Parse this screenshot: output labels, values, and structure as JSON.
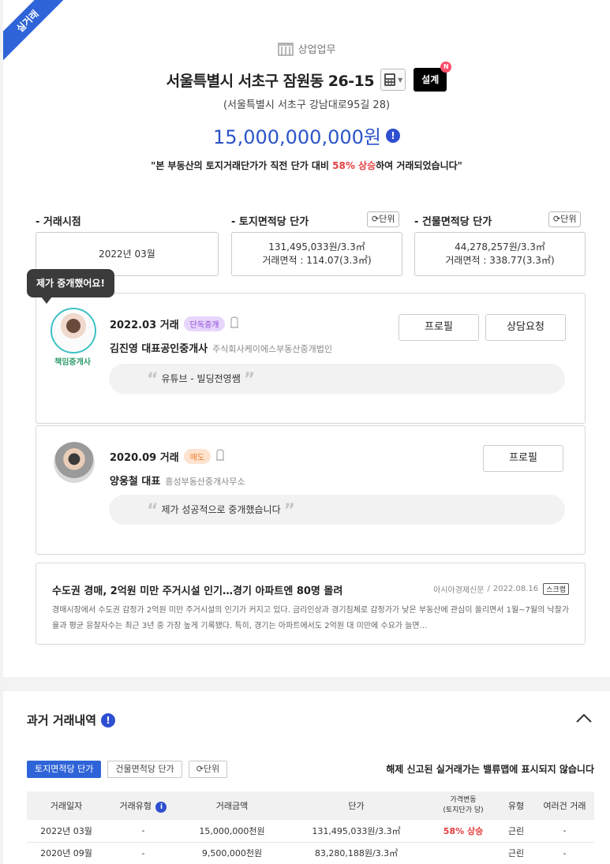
{
  "ribbon": "실거래",
  "category": "상업업무",
  "address": "서울특별시 서초구 잠원동 26-15",
  "design_label": "설계",
  "design_new": "N",
  "road_address": "(서울특별시 서초구 강남대로95길 28)",
  "price": "15,000,000,000원",
  "message_pre": "\"본 부동산의 토지거래단가가 직전 단가 대비",
  "message_highlight": "58% 상승",
  "message_post": "하여 거래되었습니다\"",
  "colors": {
    "accent_blue": "#2f64d8",
    "price_blue": "#2b54c8",
    "rise_red": "#e63e3e"
  },
  "summary": {
    "trade_date": {
      "label": "- 거래시점",
      "value": "2022년 03월"
    },
    "land_unit": {
      "label": "- 토지면적당 단가",
      "unit_btn": "단위",
      "line1": "131,495,033원/3.3㎡",
      "line2": "거래면적 : 114.07(3.3㎡)"
    },
    "building_unit": {
      "label": "- 건물면적당 단가",
      "unit_btn": "단위",
      "line1": "44,278,257원/3.3㎡",
      "line2": "거래면적 : 338.77(3.3㎡)"
    }
  },
  "tooltip": "제가 중개했어요!",
  "agents": [
    {
      "deal": "2022.03 거래",
      "badge": "단독중개",
      "name": "김진영 대표공인중개사",
      "company": "주식회사케이에스부동산중개법인",
      "tag": "책임중개사",
      "quote": "유튜브 - 빌딩전영쌤",
      "btn_profile": "프로필",
      "btn_consult": "상담요청"
    },
    {
      "deal": "2020.09 거래",
      "badge": "매도",
      "name": "양웅철 대표",
      "company": "흥성부동산중개사무소",
      "quote": "제가 성공적으로 중개했습니다",
      "btn_profile": "프로필"
    }
  ],
  "news": {
    "title": "수도권 경매, 2억원 미만 주거시설 인기…경기 아파트엔 80명 몰려",
    "source": "아시아경제신문",
    "date": "2022.08.16",
    "scrap": "스크랩",
    "body": "경매시장에서 수도권 감정가 2억원 미만 주거시설의 인기가 커지고 있다. 금리인상과 경기침체로 감정가가 낮은 부동산에 관심이 쏠리면서 1월~7월의 낙찰가율과 평균 응찰자수는 최근 3년 중 가장 높게 기록됐다. 특히, 경기는 아파트에서도 2억원 대 미만에 수요가 늘면…"
  },
  "history": {
    "title": "과거 거래내역",
    "tabs": [
      "토지면적당 단가",
      "건물면적당 단가",
      "단위"
    ],
    "notice": "해제 신고된 실거래가는 밸류맵에 표시되지 않습니다",
    "headers": [
      "거래일자",
      "거래유형",
      "거래금액",
      "단가",
      "가격변동",
      "(토지단가 당)",
      "유형",
      "여러건 거래"
    ],
    "rows": [
      [
        "2022년 03월",
        "-",
        "15,000,000천원",
        "131,495,033원/3.3㎡",
        "58% 상승",
        "근린",
        "-"
      ],
      [
        "2020년 09월",
        "-",
        "9,500,000천원",
        "83,280,188원/3.3㎡",
        "",
        "근린",
        "-"
      ]
    ]
  }
}
